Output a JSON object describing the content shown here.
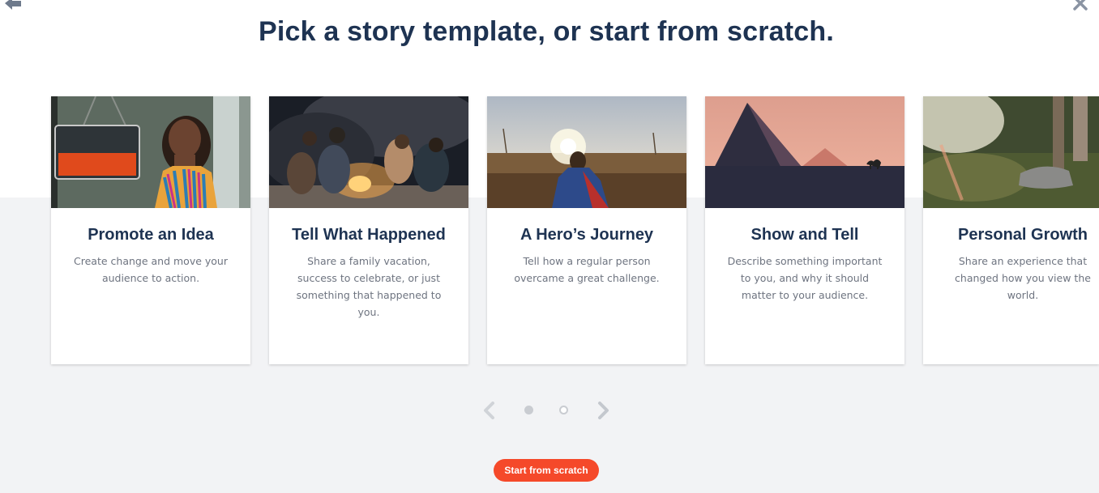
{
  "header": {
    "title": "Pick a story template, or start from scratch.",
    "back_icon": "arrow-left-icon",
    "close_icon": "close-icon"
  },
  "templates": [
    {
      "title": "Promote an Idea",
      "description": "Create change and move your audience to action.",
      "image": "woman-open-sign-photo"
    },
    {
      "title": "Tell What Happened",
      "description": "Share a family vacation, success to celebrate, or just something that happened to you.",
      "image": "campfire-friends-photo"
    },
    {
      "title": "A Hero’s Journey",
      "description": "Tell how a regular person overcame a great challenge.",
      "image": "child-in-field-photo"
    },
    {
      "title": "Show and Tell",
      "description": "Describe something important to you, and why it should matter to your audience.",
      "image": "pyramids-camel-photo"
    },
    {
      "title": "Personal Growth",
      "description": "Share an experience that changed how you view the world.",
      "image": "hiker-feet-photo"
    }
  ],
  "pagination": {
    "current_page": 1,
    "total_pages": 2,
    "prev_icon": "chevron-left-icon",
    "next_icon": "chevron-right-icon"
  },
  "start_button": {
    "label": "Start from scratch"
  },
  "colors": {
    "title": "#1e3352",
    "accent": "#f5492a",
    "background": "#f2f3f5"
  }
}
